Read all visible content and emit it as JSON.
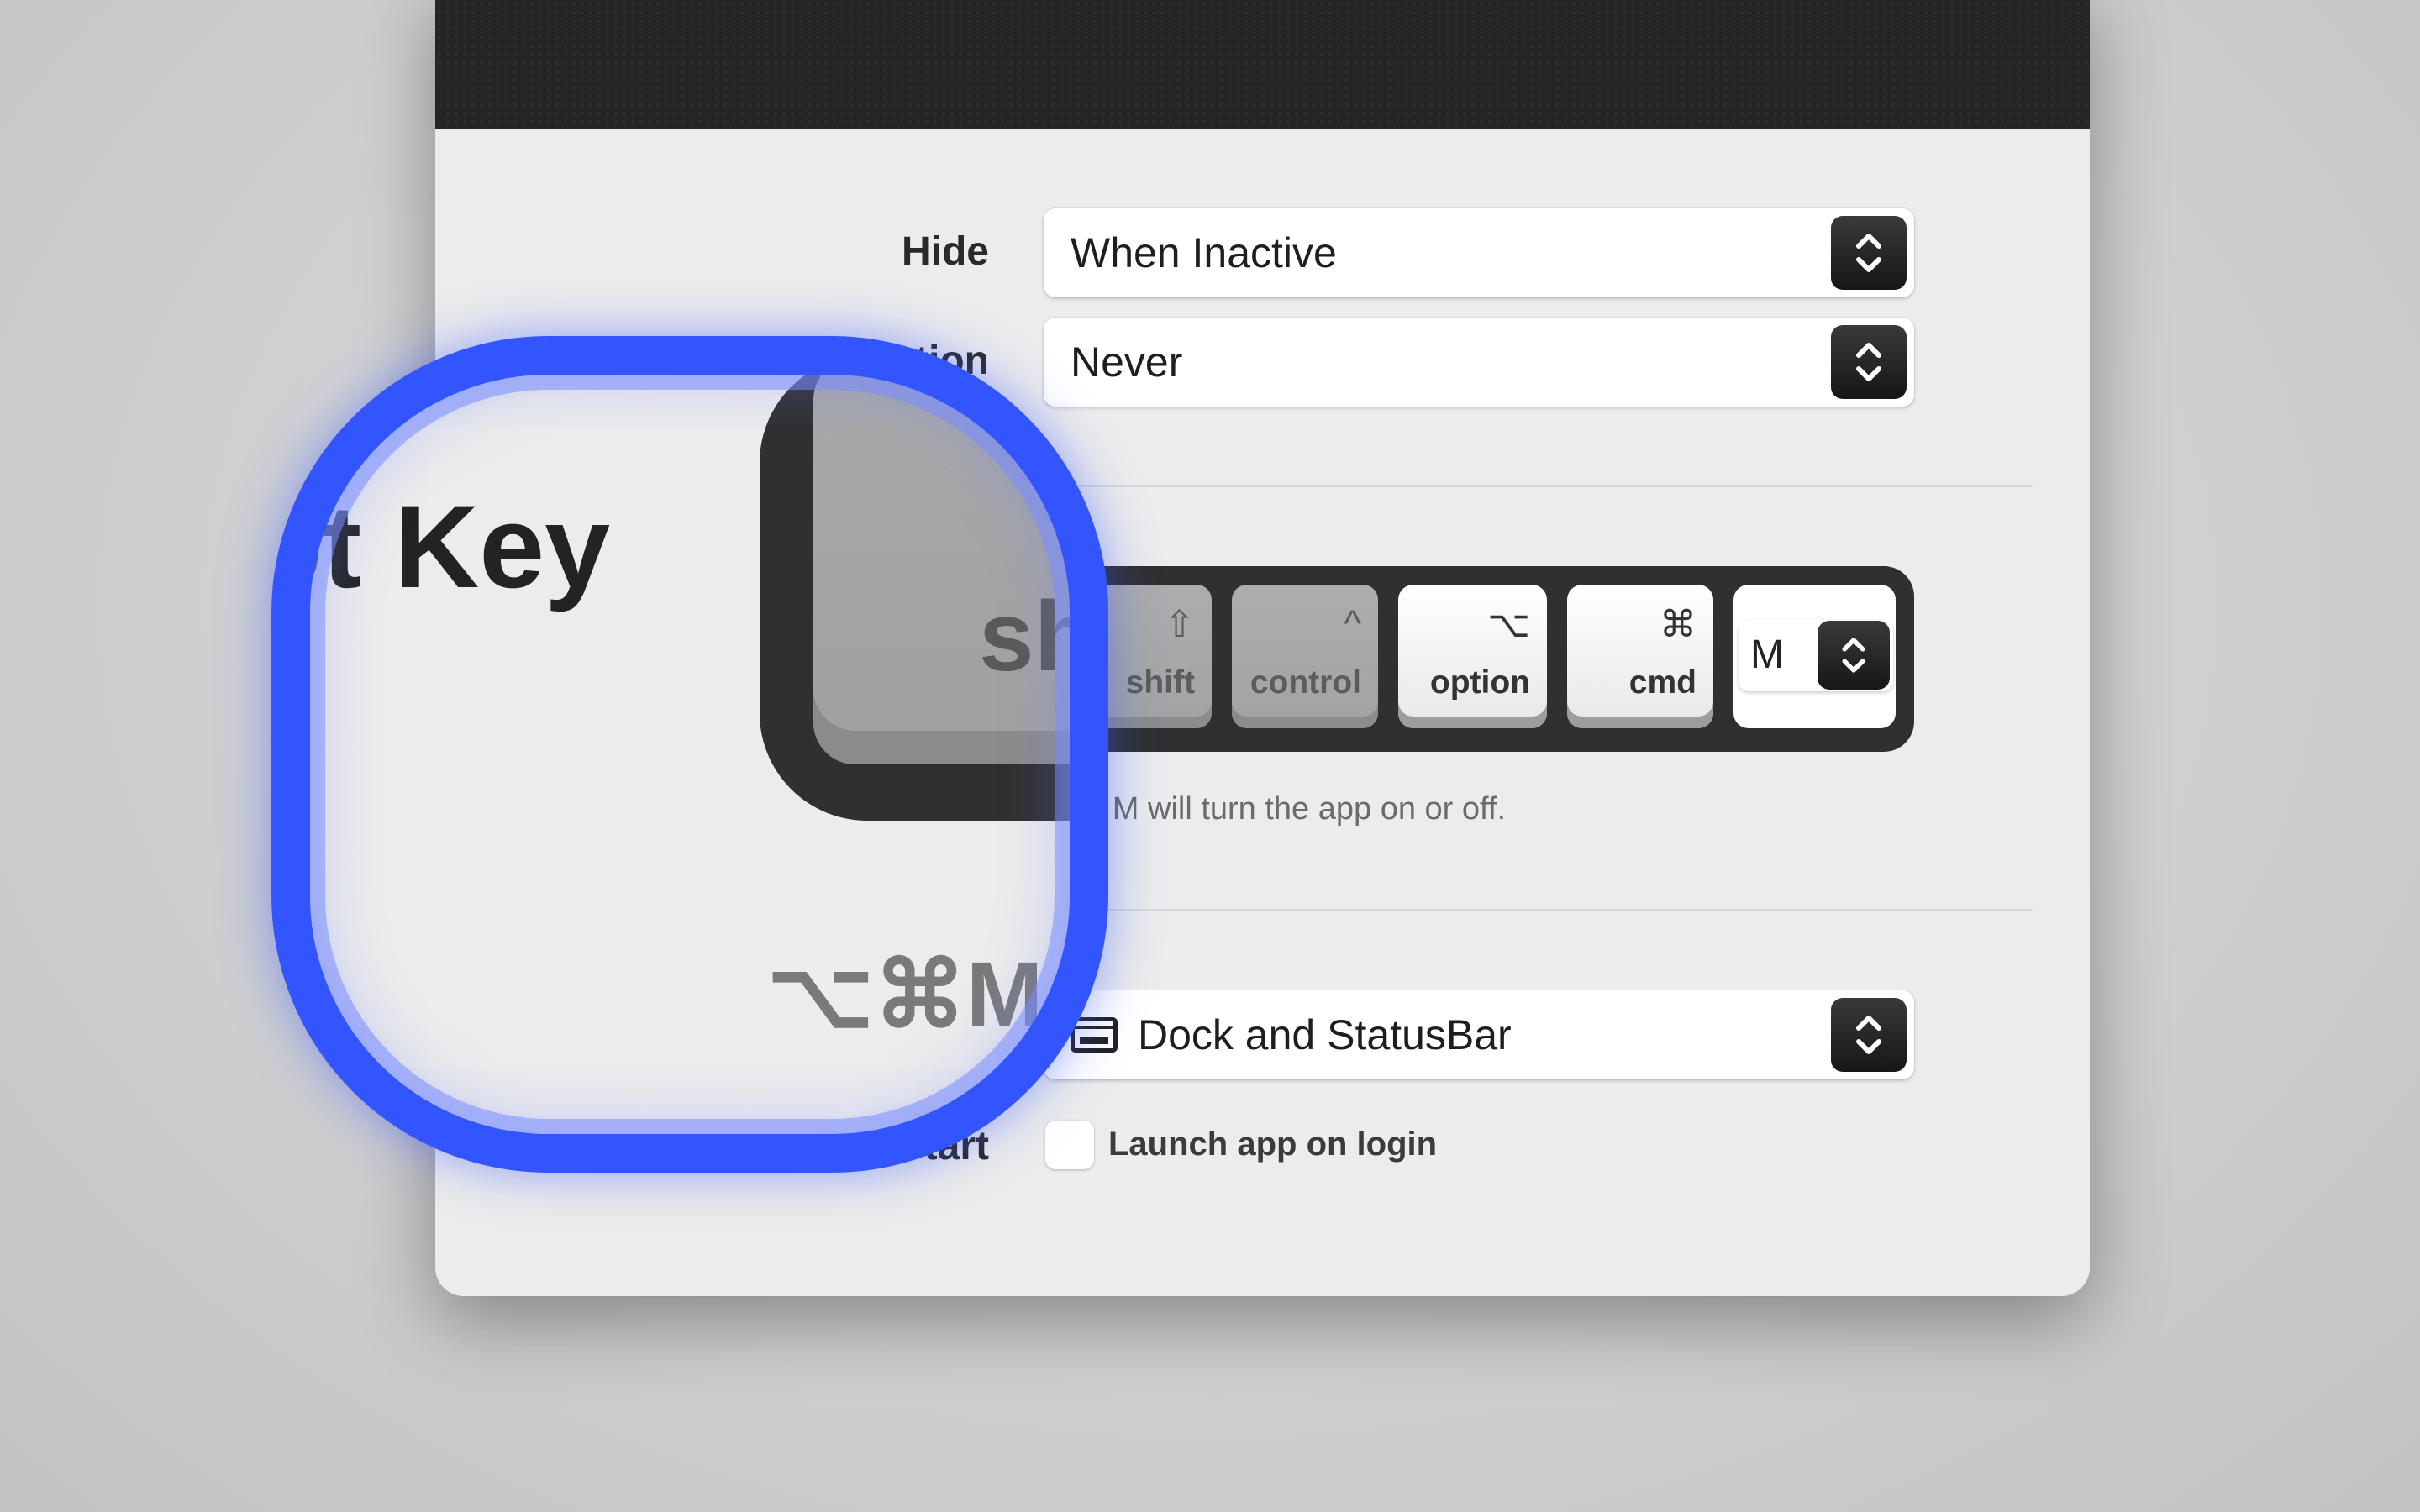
{
  "settings": {
    "hide": {
      "label": "Hide",
      "value": "When Inactive"
    },
    "second": {
      "label_visible": "tion",
      "value": "Never"
    },
    "hotkey": {
      "label_visible": "ot Key",
      "modifiers": [
        {
          "name": "shift",
          "symbol": "⇧",
          "active": false
        },
        {
          "name": "control",
          "symbol": "^",
          "active": false
        },
        {
          "name": "option",
          "symbol": "⌥",
          "active": true
        },
        {
          "name": "cmd",
          "symbol": "⌘",
          "active": true
        }
      ],
      "key": "M",
      "hint": "⌥⌘M will turn the app on or off.",
      "magnified_key": "sh",
      "magnified_hint": "⌥⌘M w"
    },
    "show_in": {
      "value": "Dock and StatusBar",
      "icon": "dock-window-icon"
    },
    "start": {
      "label_visible": "tart",
      "checkbox_label": "Launch app on login",
      "checked": false
    }
  },
  "colors": {
    "magnifier_ring": "#3355ff",
    "header": "#252525",
    "window": "#ececec"
  }
}
